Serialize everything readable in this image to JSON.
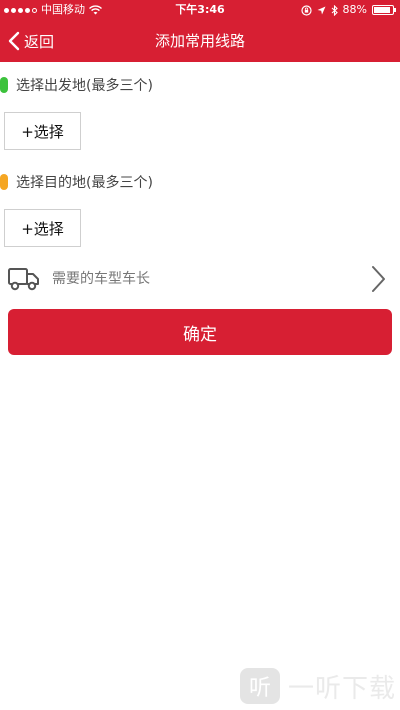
{
  "status_bar": {
    "carrier": "中国移动",
    "time": "下午3:46",
    "battery_percent": "88%",
    "battery_level": 0.88,
    "icons": [
      "signal-dots",
      "wifi-icon",
      "orientation-lock-icon",
      "location-icon",
      "bluetooth-icon",
      "battery-icon"
    ]
  },
  "nav": {
    "back_label": "返回",
    "title": "添加常用线路"
  },
  "departure": {
    "label": "选择出发地(最多三个)",
    "marker_color": "#3cc23c",
    "button_label": "+选择"
  },
  "destination": {
    "label": "选择目的地(最多三个)",
    "marker_color": "#f5a623",
    "button_label": "+选择"
  },
  "vehicle": {
    "label": "需要的车型车长",
    "icon": "truck-icon"
  },
  "confirm_label": "确定",
  "watermark": {
    "logo_glyph": "听",
    "text": "一听下载"
  },
  "colors": {
    "brand_red": "#d71f33"
  }
}
